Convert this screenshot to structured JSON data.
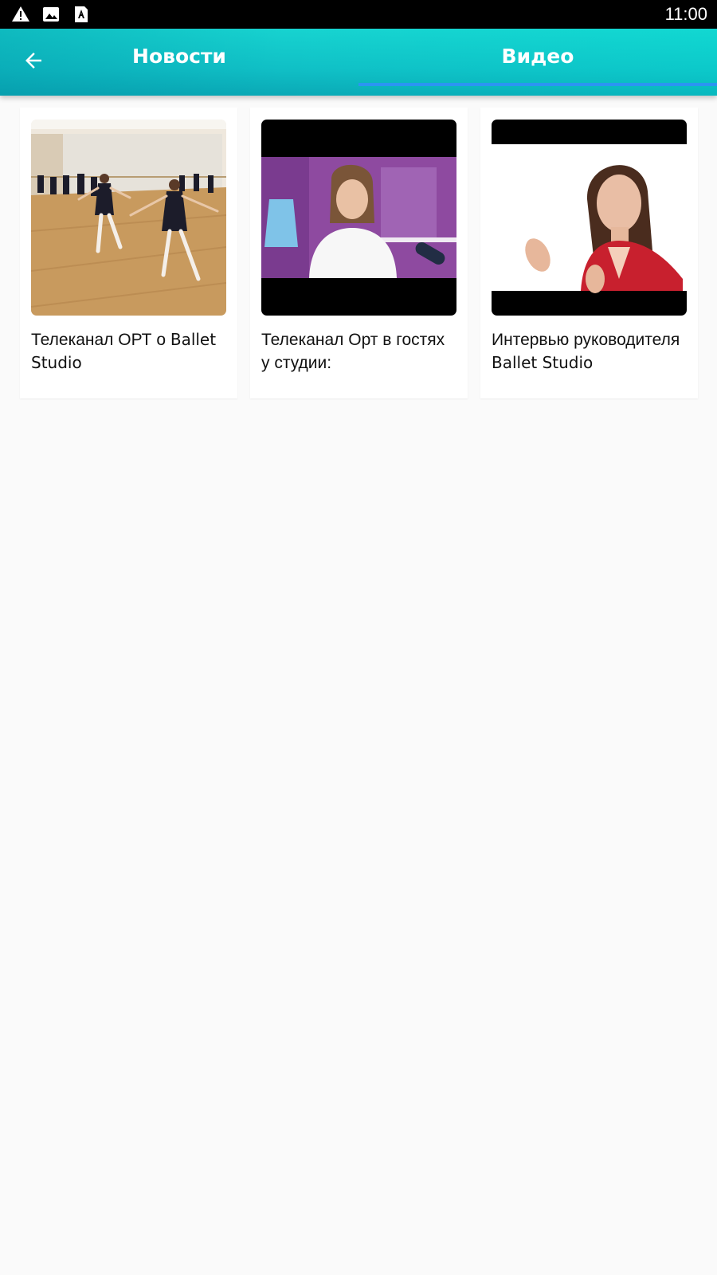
{
  "status_bar": {
    "time": "11:00",
    "icons": [
      "warning-icon",
      "image-icon",
      "font-a-icon"
    ]
  },
  "app_bar": {
    "back_icon": "arrow-left-icon",
    "tabs": [
      {
        "label": "Новости",
        "selected": false
      },
      {
        "label": "Видео",
        "selected": true
      }
    ],
    "gradient": [
      "#17d3d0",
      "#0aa9b6"
    ],
    "indicator_color": "#2b95f2"
  },
  "videos": [
    {
      "title_prefix": "Телеканал ОРТ о ",
      "title_brand": "Ballet Studio"
    },
    {
      "title_prefix": "Телеканал Орт в гостях у студии:",
      "title_brand": ""
    },
    {
      "title_prefix": "Интервью руководителя ",
      "title_brand": "Ballet Studio"
    }
  ],
  "colors": {
    "background": "#fafafa",
    "card": "#ffffff",
    "text": "#111111"
  }
}
